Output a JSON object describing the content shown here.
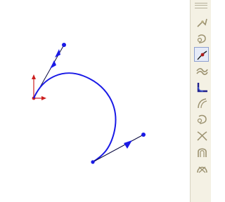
{
  "canvas": {
    "curve_color": "#1a1ae6",
    "origin_color": "#cc1f1f",
    "tangent_color": "#0a0a40"
  },
  "toolbar": {
    "tools": [
      {
        "icon": "spline-edit-icon",
        "active": false
      },
      {
        "icon": "spline-point-icon",
        "active": false
      },
      {
        "icon": "tangent-control-icon",
        "active": true
      },
      {
        "icon": "wave-curve-icon",
        "active": false
      },
      {
        "icon": "corner-curve-icon",
        "active": false
      },
      {
        "icon": "arc-tangent-icon",
        "active": false
      },
      {
        "icon": "spline-add-point-icon",
        "active": false
      },
      {
        "icon": "cross-curve-icon",
        "active": false
      },
      {
        "icon": "arch-icon",
        "active": false
      },
      {
        "icon": "arch-cross-icon",
        "active": false
      }
    ]
  }
}
